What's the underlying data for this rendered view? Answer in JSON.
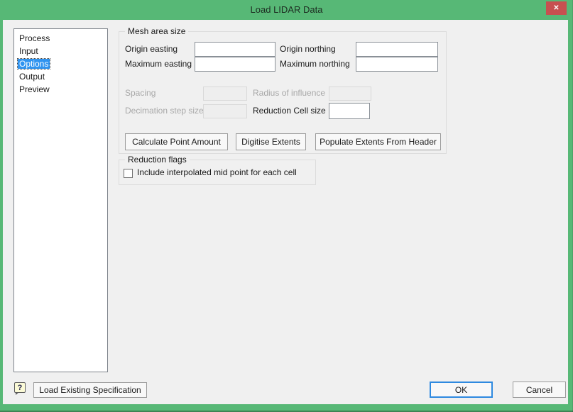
{
  "window": {
    "title": "Load LIDAR Data",
    "close_glyph": "✕"
  },
  "sidebar": {
    "items": [
      {
        "label": "Process",
        "selected": false
      },
      {
        "label": "Input",
        "selected": false
      },
      {
        "label": "Options",
        "selected": true
      },
      {
        "label": "Output",
        "selected": false
      },
      {
        "label": "Preview",
        "selected": false
      }
    ]
  },
  "mesh_group": {
    "title": "Mesh area size",
    "fields": [
      {
        "label": "Origin easting",
        "value": "",
        "enabled": true
      },
      {
        "label": "Origin northing",
        "value": "",
        "enabled": true
      },
      {
        "label": "Maximum easting",
        "value": "",
        "enabled": true
      },
      {
        "label": "Maximum northing",
        "value": "",
        "enabled": true
      },
      {
        "label": "Spacing",
        "value": "",
        "enabled": false
      },
      {
        "label": "Radius of influence",
        "value": "",
        "enabled": false
      },
      {
        "label": "Decimation step size",
        "value": "",
        "enabled": false
      },
      {
        "label": "Reduction Cell size",
        "value": "",
        "enabled": true
      }
    ],
    "buttons": [
      {
        "label": "Calculate Point Amount"
      },
      {
        "label": "Digitise Extents"
      },
      {
        "label": "Populate Extents From Header"
      }
    ]
  },
  "reduction_group": {
    "title": "Reduction flags",
    "checkbox": {
      "label": "Include interpolated mid point for each cell",
      "checked": false
    }
  },
  "footer": {
    "help_glyph": "?",
    "load_spec_button": "Load Existing Specification",
    "ok_button": "OK",
    "cancel_button": "Cancel"
  },
  "colors": {
    "titlebar_green": "#57b876",
    "close_red": "#c75050",
    "selection_blue": "#3094f0",
    "accent_blue": "#2f8ae0",
    "client_bg": "#f0f0f0"
  }
}
